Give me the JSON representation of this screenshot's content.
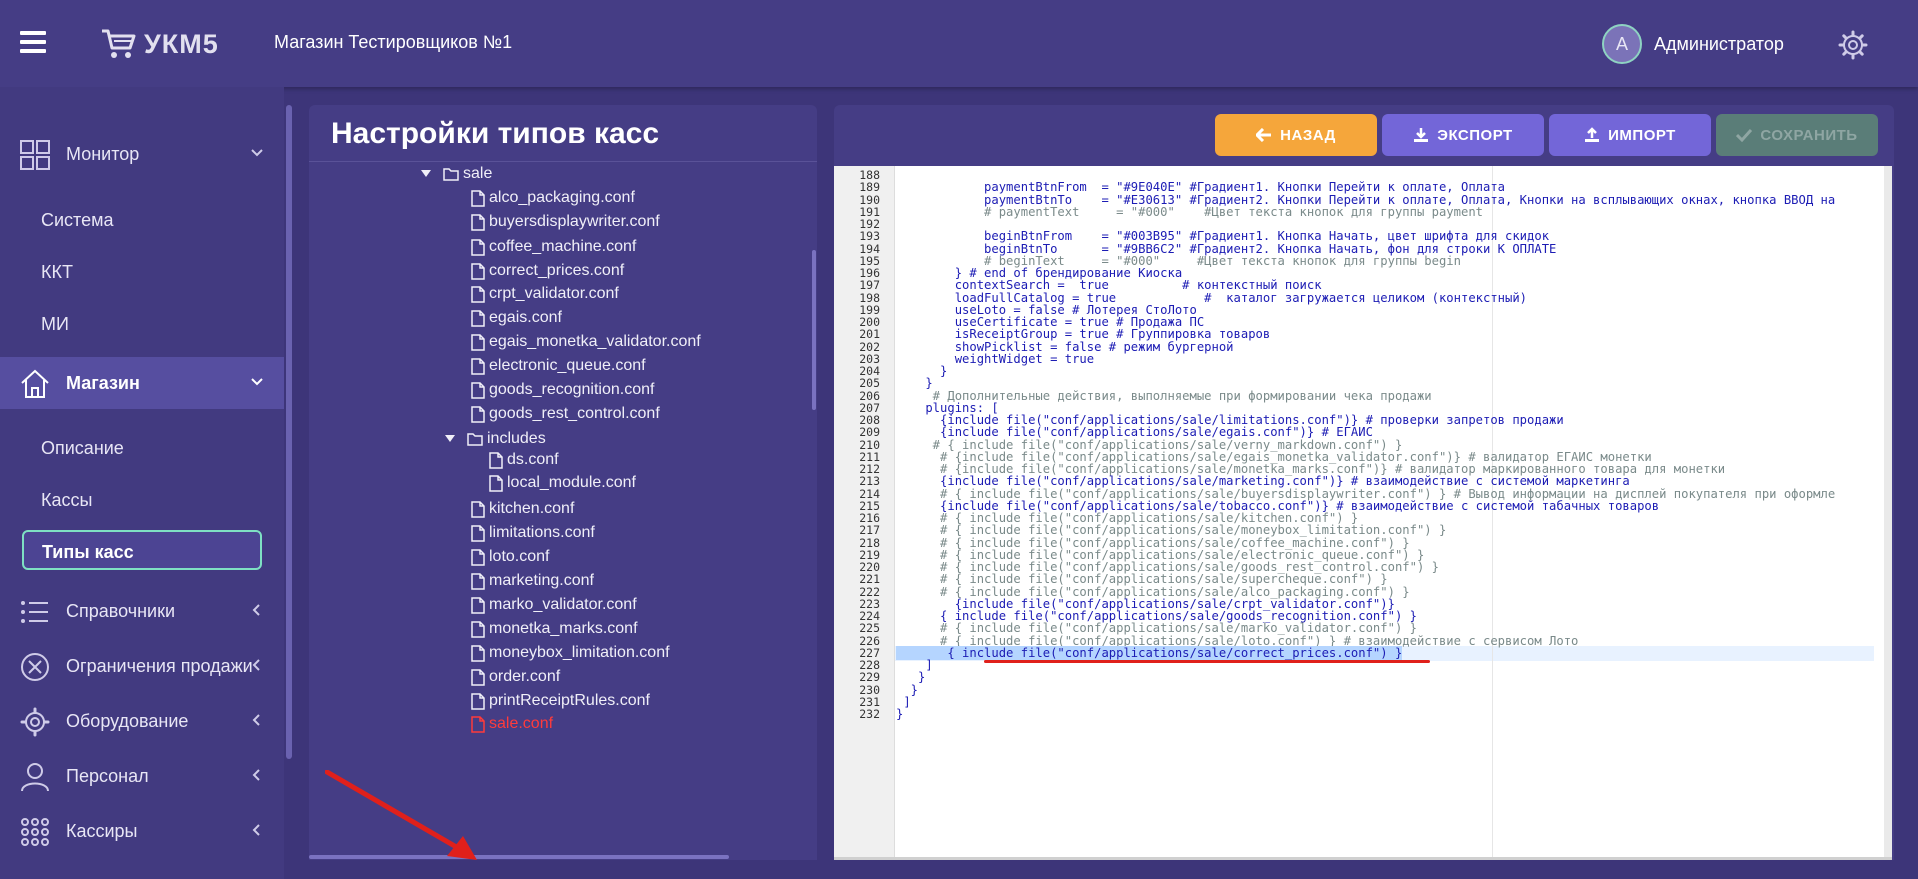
{
  "header": {
    "logo_text": "УКМ5",
    "store_name": "Магазин Тестировщиков №1",
    "avatar_letter": "A",
    "user_name": "Администратор"
  },
  "sidebar": {
    "items": [
      {
        "label": "Монитор",
        "icon": "dashboard-icon"
      },
      {
        "label": "Магазин",
        "icon": "home-icon"
      },
      {
        "label": "Справочники",
        "icon": "list-icon"
      },
      {
        "label": "Ограничения продажи",
        "icon": "restriction-icon"
      },
      {
        "label": "Оборудование",
        "icon": "gear-icon"
      },
      {
        "label": "Персонал",
        "icon": "person-icon"
      },
      {
        "label": "Кассиры",
        "icon": "grid-dots-icon"
      }
    ],
    "monitor_sub": [
      "Система",
      "ККТ",
      "МИ"
    ],
    "store_sub": [
      "Описание",
      "Кассы",
      "Типы касс"
    ]
  },
  "tree_panel": {
    "title": "Настройки типов касс",
    "items": [
      {
        "label": "sale",
        "type": "folder",
        "depth": 0
      },
      {
        "label": "alco_packaging.conf",
        "type": "file",
        "depth": 1
      },
      {
        "label": "buyersdisplaywriter.conf",
        "type": "file",
        "depth": 1
      },
      {
        "label": "coffee_machine.conf",
        "type": "file",
        "depth": 1
      },
      {
        "label": "correct_prices.conf",
        "type": "file",
        "depth": 1
      },
      {
        "label": "crpt_validator.conf",
        "type": "file",
        "depth": 1
      },
      {
        "label": "egais.conf",
        "type": "file",
        "depth": 1
      },
      {
        "label": "egais_monetka_validator.conf",
        "type": "file",
        "depth": 1
      },
      {
        "label": "electronic_queue.conf",
        "type": "file",
        "depth": 1
      },
      {
        "label": "goods_recognition.conf",
        "type": "file",
        "depth": 1
      },
      {
        "label": "goods_rest_control.conf",
        "type": "file",
        "depth": 1
      },
      {
        "label": "includes",
        "type": "folder",
        "depth": 1
      },
      {
        "label": "ds.conf",
        "type": "file",
        "depth": 2
      },
      {
        "label": "local_module.conf",
        "type": "file",
        "depth": 2
      },
      {
        "label": "kitchen.conf",
        "type": "file",
        "depth": 1
      },
      {
        "label": "limitations.conf",
        "type": "file",
        "depth": 1
      },
      {
        "label": "loto.conf",
        "type": "file",
        "depth": 1
      },
      {
        "label": "marketing.conf",
        "type": "file",
        "depth": 1
      },
      {
        "label": "marko_validator.conf",
        "type": "file",
        "depth": 1
      },
      {
        "label": "monetka_marks.conf",
        "type": "file",
        "depth": 1
      },
      {
        "label": "moneybox_limitation.conf",
        "type": "file",
        "depth": 1
      },
      {
        "label": "order.conf",
        "type": "file",
        "depth": 1
      },
      {
        "label": "printReceiptRules.conf",
        "type": "file",
        "depth": 1
      },
      {
        "label": "sale.conf",
        "type": "file",
        "depth": 1,
        "selected": true
      }
    ]
  },
  "toolbar": {
    "back": "НАЗАД",
    "export": "ЭКСПОРТ",
    "import": "ИМПОРТ",
    "save": "СОХРАНИТЬ"
  },
  "editor": {
    "lines": [
      {
        "n": "188",
        "text": ""
      },
      {
        "n": "189",
        "text": "            paymentBtnFrom  = \"#9E040E\" #Градиент1. Кнопки Перейти к оплате, Оплата"
      },
      {
        "n": "190",
        "text": "            paymentBtnTo    = \"#E30613\" #Градиент2. Кнопки Перейти к оплате, Оплата, Кнопки на всплывающих окнах, кнопка ВВОД на"
      },
      {
        "n": "191",
        "text": "            # paymentText     = \"#000\"    #Цвет текста кнопок для группы payment",
        "comment": true
      },
      {
        "n": "192",
        "text": ""
      },
      {
        "n": "193",
        "text": "            beginBtnFrom    = \"#003B95\" #Градиент1. Кнопка Начать, цвет шрифта для скидок"
      },
      {
        "n": "194",
        "text": "            beginBtnTo      = \"#9BB6C2\" #Градиент2. Кнопка Начать, фон для строки К ОПЛАТЕ"
      },
      {
        "n": "195",
        "text": "            # beginText     = \"#000\"     #Цвет текста кнопок для группы begin",
        "comment": true
      },
      {
        "n": "196",
        "text": "        } # end of брендирование Киоска"
      },
      {
        "n": "197",
        "text": "        contextSearch =  true          # контекстный поиск"
      },
      {
        "n": "198",
        "text": "        loadFullCatalog = true            #  каталог загружается целиком (контекстный)"
      },
      {
        "n": "199",
        "text": "        useLoto = false # Лотерея СтоЛото"
      },
      {
        "n": "200",
        "text": "        useCertificate = true # Продажа ПС"
      },
      {
        "n": "201",
        "text": "        isReceiptGroup = true # Группировка товаров"
      },
      {
        "n": "202",
        "text": "        showPicklist = false # режим бургерной"
      },
      {
        "n": "203",
        "text": "        weightWidget = true"
      },
      {
        "n": "204",
        "text": "      }"
      },
      {
        "n": "205",
        "text": "    }"
      },
      {
        "n": "206",
        "text": "     # Дополнительные действия, выполняемые при формировании чека продажи",
        "comment": true
      },
      {
        "n": "207",
        "text": "    plugins: ["
      },
      {
        "n": "208",
        "text": "      {include file(\"conf/applications/sale/limitations.conf\")} # проверки запретов продажи"
      },
      {
        "n": "209",
        "text": "      {include file(\"conf/applications/sale/egais.conf\")} # ЕГАИС"
      },
      {
        "n": "210",
        "text": "     # { include file(\"conf/applications/sale/verny_markdown.conf\") }",
        "comment": true
      },
      {
        "n": "211",
        "text": "      # {include file(\"conf/applications/sale/egais_monetka_validator.conf\")} # валидатор ЕГАИС монетки",
        "comment": true
      },
      {
        "n": "212",
        "text": "      # {include file(\"conf/applications/sale/monetka_marks.conf\")} # валидатор маркированного товара для монетки",
        "comment": true
      },
      {
        "n": "213",
        "text": "      {include file(\"conf/applications/sale/marketing.conf\")} # взаимодействие с системой маркетинга"
      },
      {
        "n": "214",
        "text": "      # { include file(\"conf/applications/sale/buyersdisplaywriter.conf\") } # Вывод информации на дисплей покупателя при оформле",
        "comment": true
      },
      {
        "n": "215",
        "text": "      {include file(\"conf/applications/sale/tobacco.conf\")} # взаимодействие с системой табачных товаров"
      },
      {
        "n": "216",
        "text": "      # { include file(\"conf/applications/sale/kitchen.conf\") }",
        "comment": true
      },
      {
        "n": "217",
        "text": "      # { include file(\"conf/applications/sale/moneybox_limitation.conf\") }",
        "comment": true
      },
      {
        "n": "218",
        "text": "      # { include file(\"conf/applications/sale/coffee_machine.conf\") }",
        "comment": true
      },
      {
        "n": "219",
        "text": "      # { include file(\"conf/applications/sale/electronic_queue.conf\") }",
        "comment": true
      },
      {
        "n": "220",
        "text": "      # { include file(\"conf/applications/sale/goods_rest_control.conf\") }",
        "comment": true
      },
      {
        "n": "221",
        "text": "      # { include file(\"conf/applications/sale/supercheque.conf\") }",
        "comment": true
      },
      {
        "n": "222",
        "text": "      # { include file(\"conf/applications/sale/alco_packaging.conf\") }",
        "comment": true
      },
      {
        "n": "223",
        "text": "        {include file(\"conf/applications/sale/crpt_validator.conf\")}"
      },
      {
        "n": "224",
        "text": "      { include file(\"conf/applications/sale/goods_recognition.conf\") }"
      },
      {
        "n": "225",
        "text": "      # { include file(\"conf/applications/sale/marko_validator.conf\") }",
        "comment": true
      },
      {
        "n": "226",
        "text": "      # { include file(\"conf/applications/sale/loto.conf\") } # взаимодействие с сервисом Лото",
        "comment": true
      },
      {
        "n": "227",
        "text": "       { include file(\"conf/applications/sale/correct_prices.conf\") }",
        "selected": true
      },
      {
        "n": "228",
        "text": "    ]"
      },
      {
        "n": "229",
        "text": "   }"
      },
      {
        "n": "230",
        "text": "  }"
      },
      {
        "n": "231",
        "text": " ]"
      },
      {
        "n": "232",
        "text": "}"
      }
    ]
  }
}
